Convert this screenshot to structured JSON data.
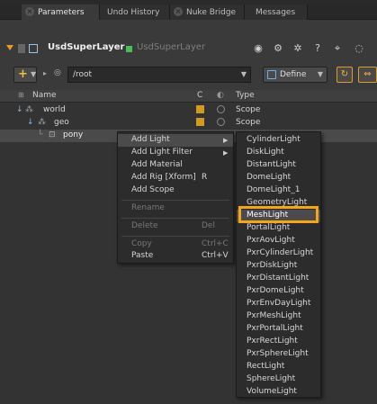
{
  "tabs": [
    "Parameters",
    "Undo History",
    "Nuke Bridge",
    "Messages"
  ],
  "node": {
    "name": "UsdSuperLayer",
    "subtitle": "UsdSuperLayer"
  },
  "toolbar": {
    "add_label": "+",
    "path_value": "/root",
    "define_label": "Define"
  },
  "tree": {
    "headers": {
      "name": "Name",
      "c": "C",
      "type": "Type"
    },
    "rows": [
      {
        "name": "world",
        "type": "Scope"
      },
      {
        "name": "geo",
        "type": "Scope"
      },
      {
        "name": "pony",
        "type": ""
      }
    ]
  },
  "context_menu": {
    "items": [
      {
        "label": "Add Light",
        "shortcut": "",
        "submenu": true
      },
      {
        "label": "Add Light Filter",
        "shortcut": "",
        "submenu": true
      },
      {
        "label": "Add Material",
        "shortcut": ""
      },
      {
        "label": "Add Rig [Xform]",
        "shortcut": "R"
      },
      {
        "label": "Add Scope",
        "shortcut": ""
      },
      {
        "label": "Rename",
        "shortcut": "",
        "disabled": true
      },
      {
        "label": "Delete",
        "shortcut": "Del",
        "disabled": true
      },
      {
        "label": "Copy",
        "shortcut": "Ctrl+C",
        "disabled": true
      },
      {
        "label": "Paste",
        "shortcut": "Ctrl+V"
      }
    ]
  },
  "light_submenu": [
    "CylinderLight",
    "DiskLight",
    "DistantLight",
    "DomeLight",
    "DomeLight_1",
    "GeometryLight",
    "MeshLight",
    "PortalLight",
    "PxrAovLight",
    "PxrCylinderLight",
    "PxrDiskLight",
    "PxrDistantLight",
    "PxrDomeLight",
    "PxrEnvDayLight",
    "PxrMeshLight",
    "PxrPortalLight",
    "PxrRectLight",
    "PxrSphereLight",
    "RectLight",
    "SphereLight",
    "VolumeLight"
  ],
  "highlighted_item": "MeshLight",
  "colors": {
    "accent_orange": "#f5a41b",
    "node_green": "#4dbb58",
    "badge": "#d19a22"
  }
}
